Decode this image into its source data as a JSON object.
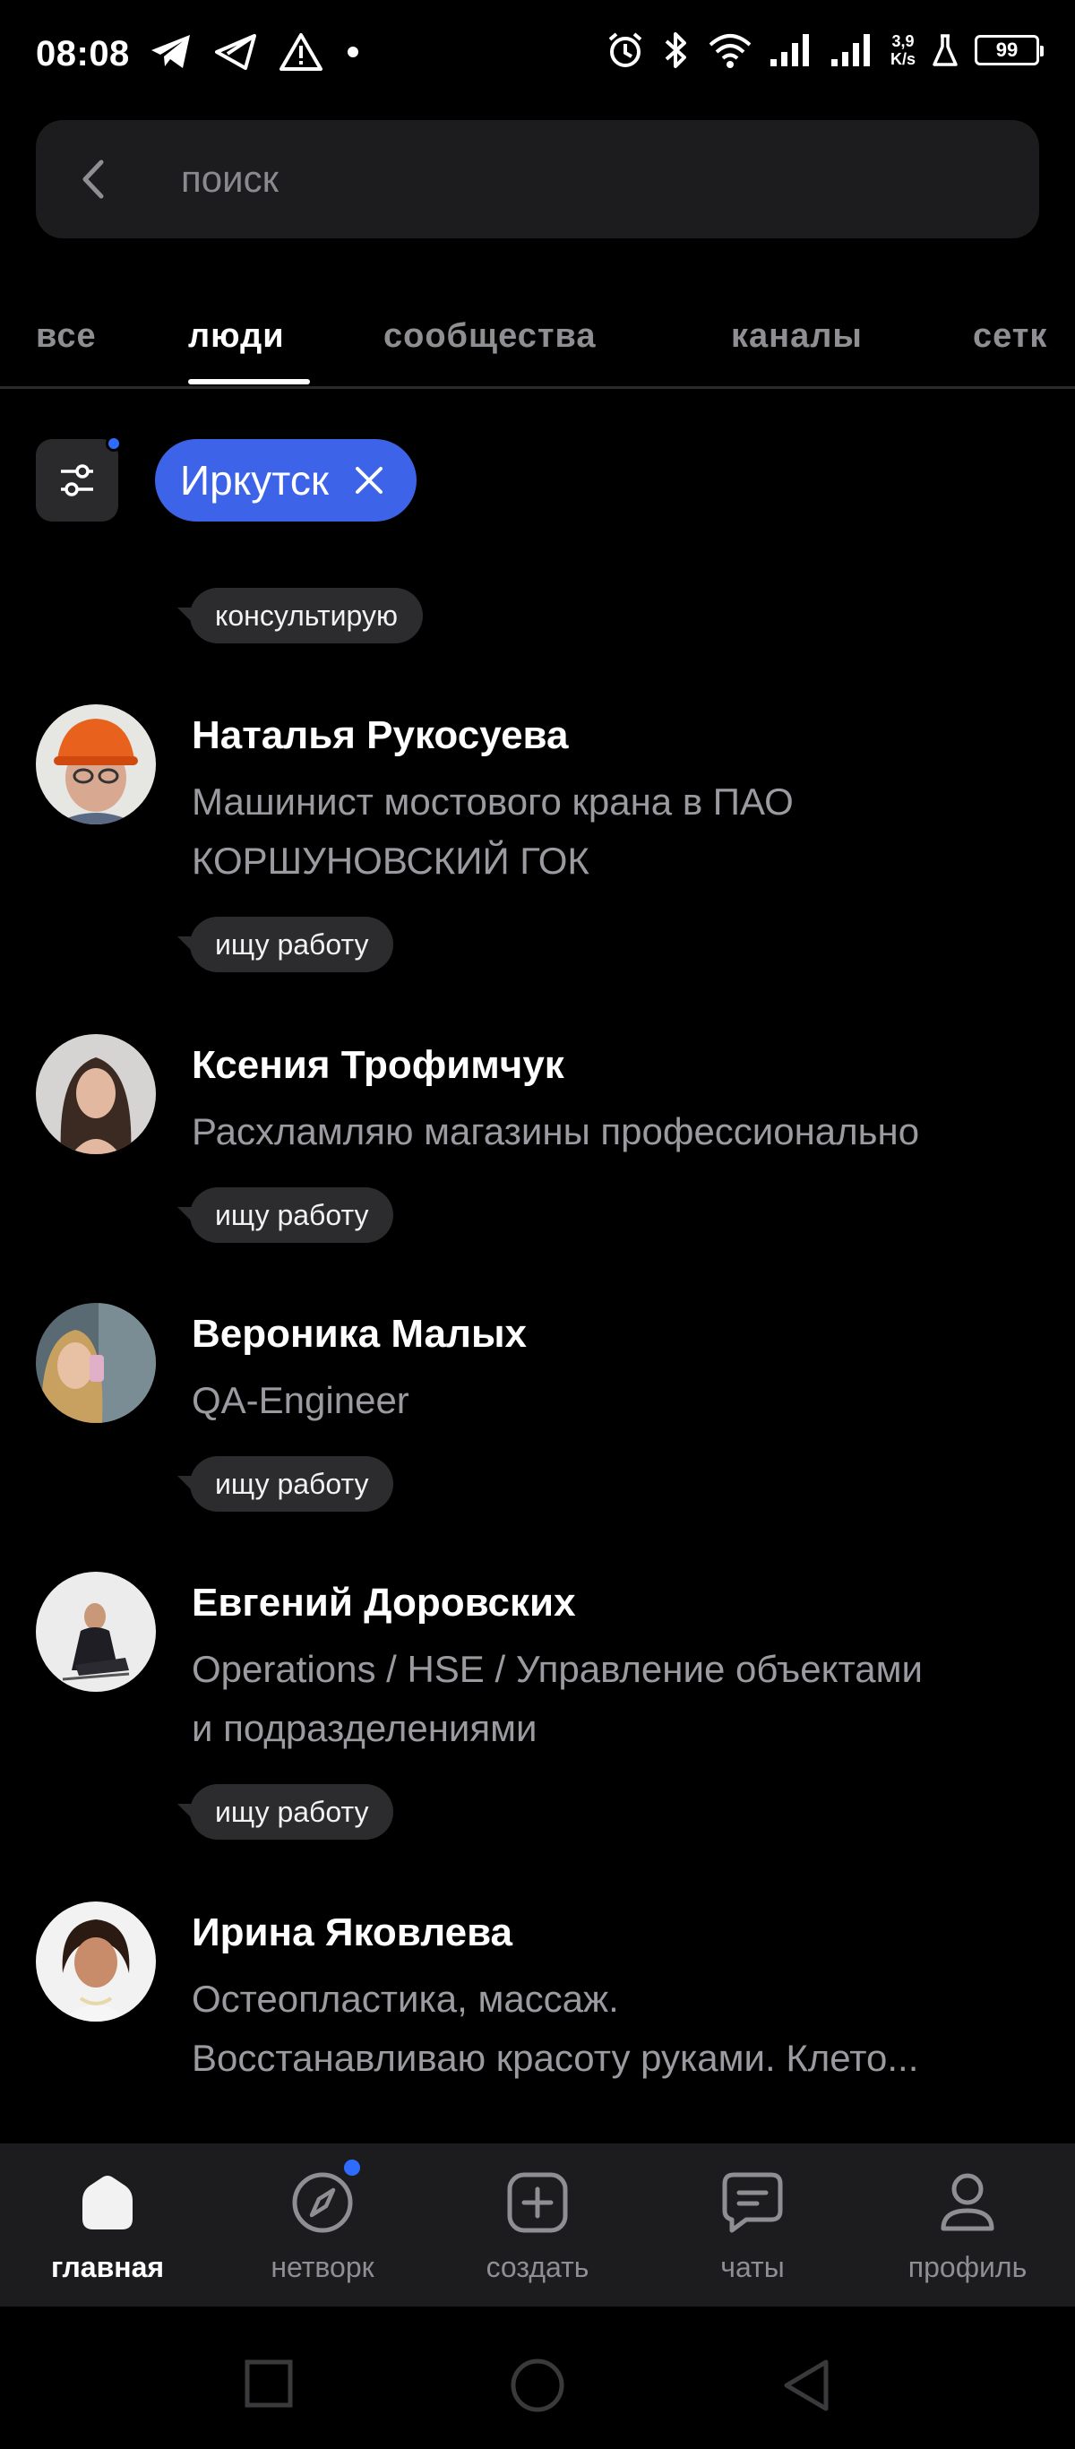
{
  "status_bar": {
    "time": "08:08",
    "network_speed_value": "3,9",
    "network_speed_unit": "K/s",
    "battery": "99"
  },
  "search": {
    "placeholder": "поиск"
  },
  "tabs": [
    {
      "label": "все",
      "active": false
    },
    {
      "label": "люди",
      "active": true
    },
    {
      "label": "сообщества",
      "active": false
    },
    {
      "label": "каналы",
      "active": false
    },
    {
      "label": "сетк",
      "active": false
    }
  ],
  "filters": {
    "city_chip": "Иркутск"
  },
  "top_tag": "консультирую",
  "people": [
    {
      "name": "Наталья Рукосуева",
      "description_line1": "Машинист мостового крана в ПАО",
      "description_line2": "КОРШУНОВСКИЙ ГОК",
      "tag": "ищу работу"
    },
    {
      "name": "Ксения Трофимчук",
      "description_line1": "Расхламляю магазины профессионально",
      "description_line2": "",
      "tag": "ищу работу"
    },
    {
      "name": "Вероника Малых",
      "description_line1": "QA-Engineer",
      "description_line2": "",
      "tag": "ищу работу"
    },
    {
      "name": "Евгений Доровских",
      "description_line1": "Operations / HSE / Управление объектами",
      "description_line2": "и подразделениями",
      "tag": "ищу работу"
    },
    {
      "name": "Ирина Яковлева",
      "description_line1": "Остеопластика, массаж.",
      "description_line2": "Восстанавливаю красоту руками. Клето...",
      "tag": ""
    }
  ],
  "bottom_nav": [
    {
      "label": "главная",
      "icon": "home-icon",
      "active": true
    },
    {
      "label": "нетворк",
      "icon": "compass-icon",
      "active": false,
      "badge": true
    },
    {
      "label": "создать",
      "icon": "plus-square-icon",
      "active": false
    },
    {
      "label": "чаты",
      "icon": "chat-icon",
      "active": false
    },
    {
      "label": "профиль",
      "icon": "person-icon",
      "active": false
    }
  ],
  "colors": {
    "background": "#000000",
    "surface": "#1c1c1e",
    "accent_chip": "#3d63e8",
    "badge_dot": "#2d6cff",
    "muted_text": "#9a9aa0"
  }
}
